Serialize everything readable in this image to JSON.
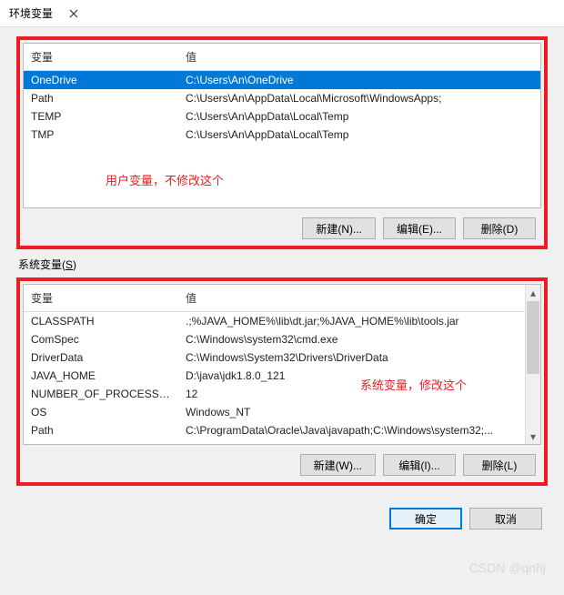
{
  "title": "环境变量",
  "columns": {
    "name": "变量",
    "value": "值"
  },
  "userVars": [
    {
      "name": "OneDrive",
      "value": "C:\\Users\\An\\OneDrive",
      "selected": true
    },
    {
      "name": "Path",
      "value": "C:\\Users\\An\\AppData\\Local\\Microsoft\\WindowsApps;",
      "selected": false
    },
    {
      "name": "TEMP",
      "value": "C:\\Users\\An\\AppData\\Local\\Temp",
      "selected": false
    },
    {
      "name": "TMP",
      "value": "C:\\Users\\An\\AppData\\Local\\Temp",
      "selected": false
    }
  ],
  "userAnnotation": "用户变量，不修改这个",
  "userButtons": {
    "new": "新建(N)...",
    "edit": "编辑(E)...",
    "delete": "删除(D)"
  },
  "systemLabel": "系统变量(S)",
  "systemVars": [
    {
      "name": "CLASSPATH",
      "value": ".;%JAVA_HOME%\\lib\\dt.jar;%JAVA_HOME%\\lib\\tools.jar"
    },
    {
      "name": "ComSpec",
      "value": "C:\\Windows\\system32\\cmd.exe"
    },
    {
      "name": "DriverData",
      "value": "C:\\Windows\\System32\\Drivers\\DriverData"
    },
    {
      "name": "JAVA_HOME",
      "value": "D:\\java\\jdk1.8.0_121"
    },
    {
      "name": "NUMBER_OF_PROCESSORS",
      "value": "12"
    },
    {
      "name": "OS",
      "value": "Windows_NT"
    },
    {
      "name": "Path",
      "value": "C:\\ProgramData\\Oracle\\Java\\javapath;C:\\Windows\\system32;..."
    }
  ],
  "systemAnnotation": "系统变量，修改这个",
  "systemButtons": {
    "new": "新建(W)...",
    "edit": "编辑(I)...",
    "delete": "删除(L)"
  },
  "footer": {
    "ok": "确定",
    "cancel": "取消"
  },
  "watermark": "CSDN @qnhj"
}
